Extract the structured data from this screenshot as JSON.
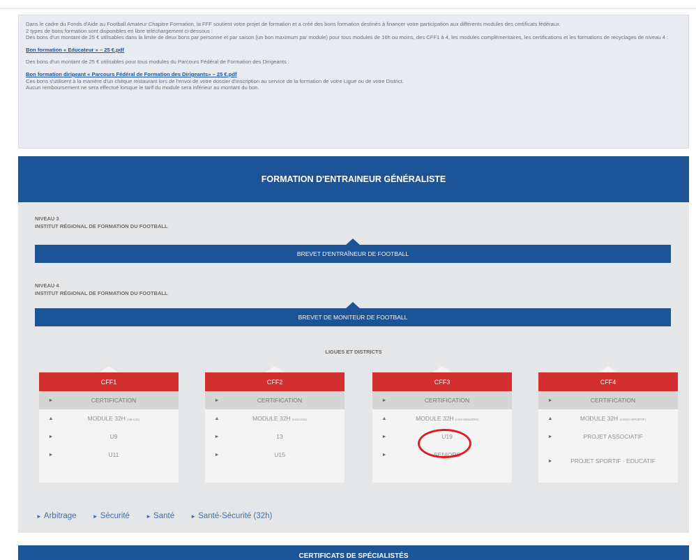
{
  "info": {
    "p1": "Dans le cadre du Fonds d'Aide au Football Amateur Chapitre Formation, la FFF soutient votre projet de formation et a créé des bons formation destinés à financer votre participation aux différents modules des certificats fédéraux.",
    "p2": "2 types de bons formation sont disponibles en libre téléchargement ci-dessous :",
    "p3": "Des bons d'un montant de 25 € utilisables dans la limite de deux bons par personne et par saison (un bon maximum par module) pour tous modules de 16h ou moins, des CFF1 à 4, les modules complémentaires, les certifications et les formations de recyclages de niveau 4 :",
    "link1": "Bon formation « Educateur » – 25 €.pdf",
    "p4": "Des bons d'un montant de 25 € utilisables pour tous modules du Parcours Fédéral de Formation des Dirigeants :",
    "link2": "Bon formation dirigeant « Parcours Fédéral de Formation des Dirigeants» – 25 €.pdf",
    "p5": "Ces bons s'utilisent à la manière d'un chèque restaurant lors de l'envoi de votre dossier d'inscription au service de la formation de votre Ligue ou de votre District.",
    "p6": "Aucun remboursement ne sera effectué lorsque le tarif du module sera inférieur au montant du bon."
  },
  "main": {
    "title": "FORMATION D'ENTRAINEUR GÉNÉRALISTE",
    "niveau3": {
      "level": "NIVEAU 3",
      "institute": "INSTITUT RÉGIONAL DE FORMATION DU FOOTBALL",
      "button": "BREVET D'ENTRAÎNEUR DE FOOTBALL"
    },
    "niveau4": {
      "level": "NIVEAU 4",
      "institute": "INSTITUT RÉGIONAL DE FORMATION DU FOOTBALL",
      "button": "BREVET DE MONITEUR DE FOOTBALL"
    },
    "ligues": "LIGUES ET DISTRICTS"
  },
  "cards": [
    {
      "title": "CFF1",
      "cert": "CERTIFICATION",
      "module": "MODULE 32H",
      "module_small": "(U6-U11)",
      "r3": "U9",
      "r4": "U11"
    },
    {
      "title": "CFF2",
      "cert": "CERTIFICATION",
      "module": "MODULE 32H",
      "module_small": "(U13-U15)",
      "r3": "13",
      "r4": "U15"
    },
    {
      "title": "CFF3",
      "cert": "CERTIFICATION",
      "module": "MODULE 32H",
      "module_small": "(U19-SENIORS)",
      "r3": "U19",
      "r4": "SENIORS"
    },
    {
      "title": "CFF4",
      "cert": "CERTIFICATION",
      "module": "MODULE 32H",
      "module_small": "(ASSO+SPORTIF)",
      "r3": "PROJET ASSOCIATIF",
      "r4": "PROJET SPORTIF - EDUCATIF"
    }
  ],
  "links": [
    "Arbitrage",
    "Sécurité",
    "Santé",
    "Santé-Sécurité (32h)"
  ],
  "footer_title": "CERTIFICATS DE SPÉCIALISTÉS",
  "colors": {
    "blue": "#1d5497",
    "red": "#d32f2f",
    "highlight": "#e11b22"
  }
}
